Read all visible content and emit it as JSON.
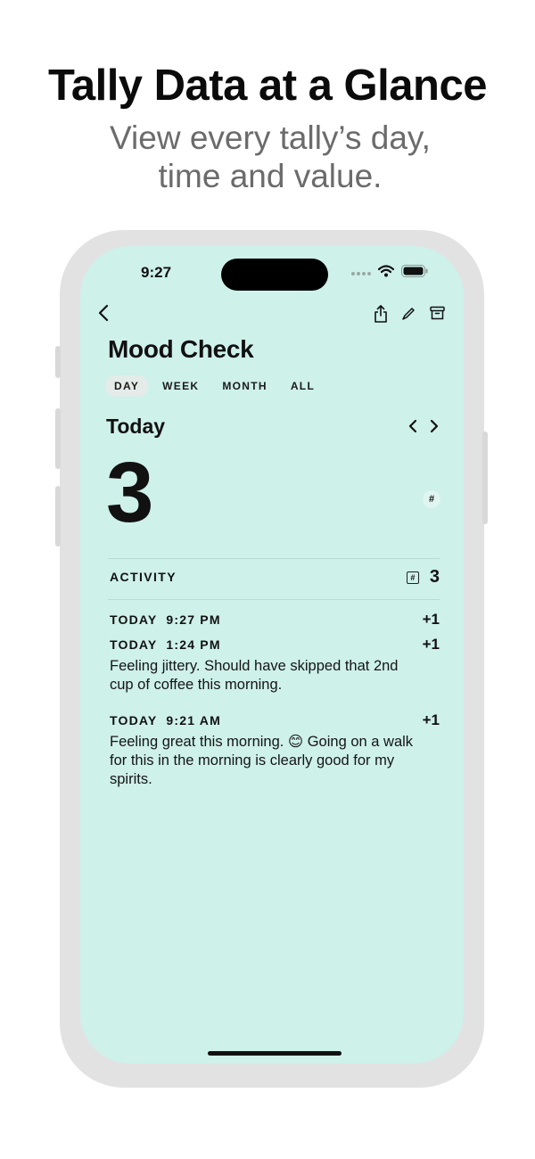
{
  "promo": {
    "headline": "Tally Data at a Glance",
    "subhead_line1": "View every tally’s day,",
    "subhead_line2": "time and value."
  },
  "status_bar": {
    "time": "9:27"
  },
  "icons": {
    "back": "back-chevron-icon",
    "share": "share-icon",
    "edit": "pencil-icon",
    "archive": "archive-icon",
    "prev": "chevron-left-icon",
    "next": "chevron-right-icon",
    "unit": "hash-icon",
    "wifi": "wifi-icon",
    "battery": "battery-icon"
  },
  "colors": {
    "screen_background": "#cef1ea",
    "active_tab": "#e4ebe9"
  },
  "tally": {
    "title": "Mood Check",
    "tabs": [
      {
        "label": "DAY",
        "active": true
      },
      {
        "label": "WEEK",
        "active": false
      },
      {
        "label": "MONTH",
        "active": false
      },
      {
        "label": "ALL",
        "active": false
      }
    ],
    "period_label": "Today",
    "value": "3",
    "unit_symbol": "#"
  },
  "activity": {
    "header": "ACTIVITY",
    "unit_symbol": "#",
    "total": "3",
    "entries": [
      {
        "time": "TODAY  9:27 PM",
        "delta": "+1",
        "note": ""
      },
      {
        "time": "TODAY  1:24 PM",
        "delta": "+1",
        "note": "Feeling jittery. Should have skipped that 2nd cup of coffee this morning."
      },
      {
        "time": "TODAY  9:21 AM",
        "delta": "+1",
        "note": "Feeling great this morning. 😊 Going on a walk for this in the morning is clearly good for my spirits."
      }
    ]
  }
}
